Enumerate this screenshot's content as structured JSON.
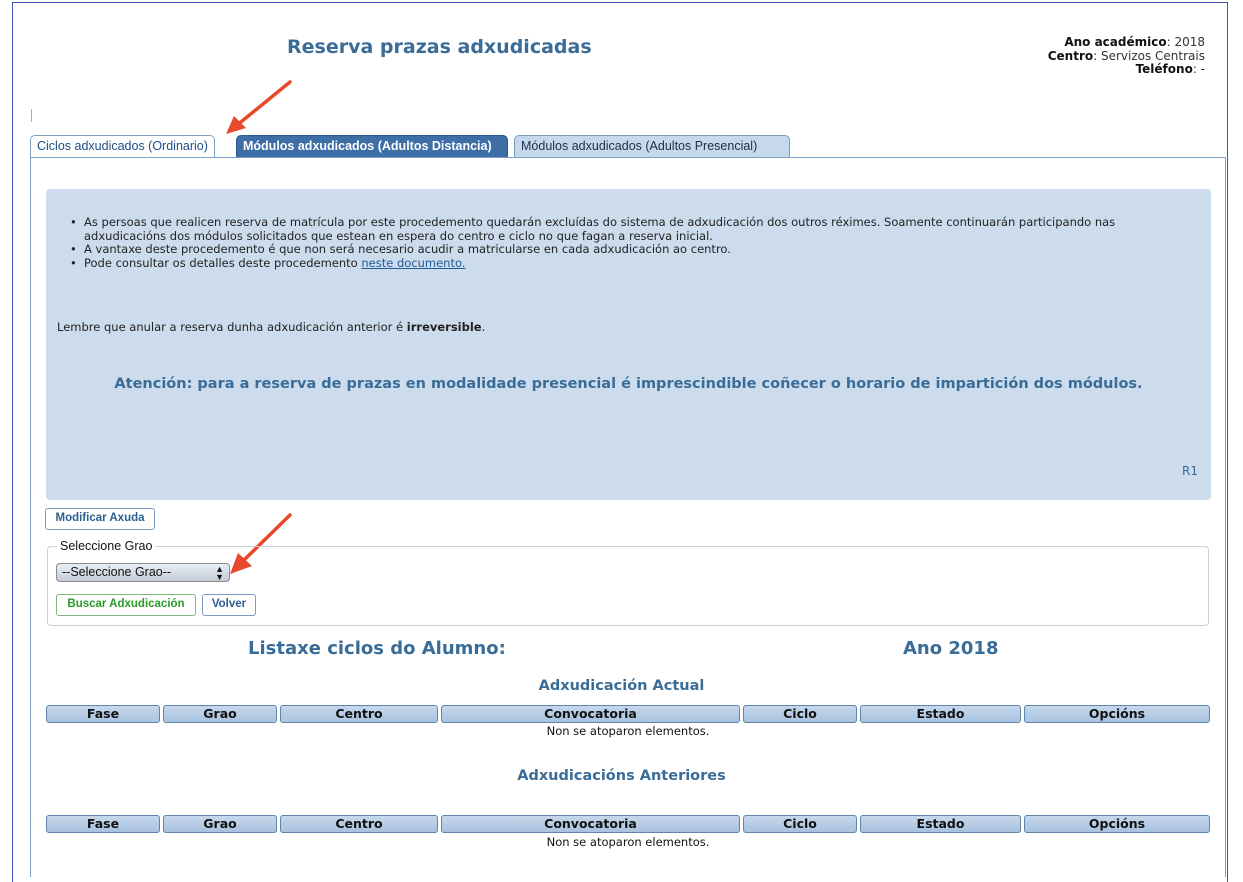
{
  "page": {
    "title": "Reserva prazas adxudicadas",
    "info": {
      "year_label": "Ano académico",
      "year_value": ": 2018",
      "centre_label": "Centro",
      "centre_value": ": Servizos Centrais",
      "phone_label": "Teléfono",
      "phone_value": ": -"
    }
  },
  "tabs": [
    {
      "label": "Ciclos adxudicados (Ordinario)"
    },
    {
      "label": "Módulos adxudicados (Adultos Distancia)"
    },
    {
      "label": "Módulos adxudicados (Adultos Presencial)"
    }
  ],
  "help": {
    "bullets": [
      "As persoas que realicen reserva de matrícula por este procedemento quedarán excluídas do sistema de adxudicación dos outros réximes. Soamente continuarán participando nas adxudicacións dos módulos solicitados que estean en espera do centro e ciclo no que fagan a reserva inicial.",
      "A vantaxe deste procedemento é que non será necesario acudir a matricularse en cada adxudicación ao centro."
    ],
    "bullet3_text": "Pode consultar os detalles deste procedemento ",
    "bullet3_link": "neste documento.",
    "remember_text": "Lembre que anular a reserva dunha adxudicación anterior é ",
    "remember_bold": "irreversible",
    "remember_end": ".",
    "attention": "Atención: para a reserva de prazas en modalidade presencial é imprescindible coñecer o horario de impartición dos módulos.",
    "code": "R1"
  },
  "buttons": {
    "modify_help": "Modificar Axuda",
    "search": "Buscar Adxudicación",
    "back": "Volver"
  },
  "grade_select": {
    "legend": "Seleccione Grao",
    "selected": "--Seleccione Grao--",
    "arrows": "▲▼"
  },
  "list": {
    "title": "Listaxe ciclos do Alumno:",
    "year": "Ano 2018"
  },
  "tables": {
    "columns": [
      "Fase",
      "Grao",
      "Centro",
      "Convocatoria",
      "Ciclo",
      "Estado",
      "Opcións"
    ],
    "current_title": "Adxudicación Actual",
    "previous_title": "Adxudicacións Anteriores",
    "empty_message": "Non se atoparon elementos."
  },
  "colors": {
    "accent": "#3a6c98",
    "annotation_arrow": "#e8492b"
  }
}
